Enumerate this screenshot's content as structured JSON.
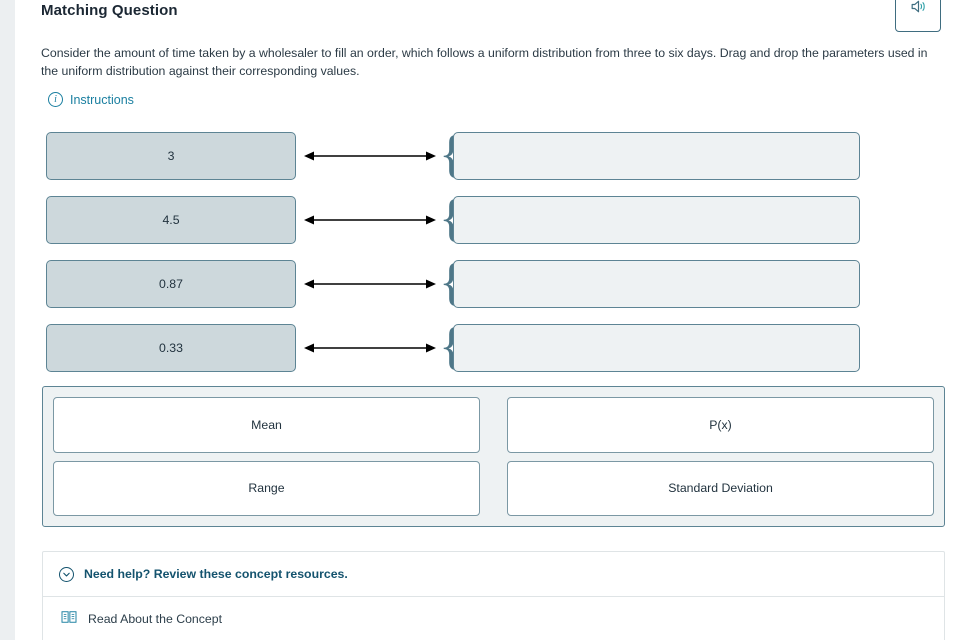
{
  "question": {
    "type_label": "Matching Question",
    "prompt": "Consider the amount of time taken by a wholesaler to fill an order, which follows a uniform distribution from three to six days. Drag and drop the parameters used in the uniform distribution against their corresponding values.",
    "instructions_label": "Instructions"
  },
  "toolbar": {
    "audio_icon": "speaker-icon"
  },
  "matching": {
    "rows": [
      {
        "value": "3",
        "dropped": "",
        "arrow_icon": "double-arrow-icon",
        "brace": "{"
      },
      {
        "value": "4.5",
        "dropped": "",
        "arrow_icon": "double-arrow-icon",
        "brace": "{"
      },
      {
        "value": "0.87",
        "dropped": "",
        "arrow_icon": "double-arrow-icon",
        "brace": "{"
      },
      {
        "value": "0.33",
        "dropped": "",
        "arrow_icon": "double-arrow-icon",
        "brace": "{"
      }
    ]
  },
  "answer_bank": {
    "options": [
      "Mean",
      "P(x)",
      "Range",
      "Standard Deviation"
    ]
  },
  "help": {
    "header": "Need help? Review these concept resources.",
    "chevron_icon": "chevron-down-circle-icon",
    "resource_icon": "open-book-icon",
    "resource_label": "Read About the Concept"
  },
  "colors": {
    "accent": "#1a7fa0",
    "tile_fill": "#cdd8dc",
    "tile_border": "#5d8494",
    "dropzone_fill": "#eef2f3",
    "help_text": "#14536e",
    "gutter": "#eceff1"
  }
}
